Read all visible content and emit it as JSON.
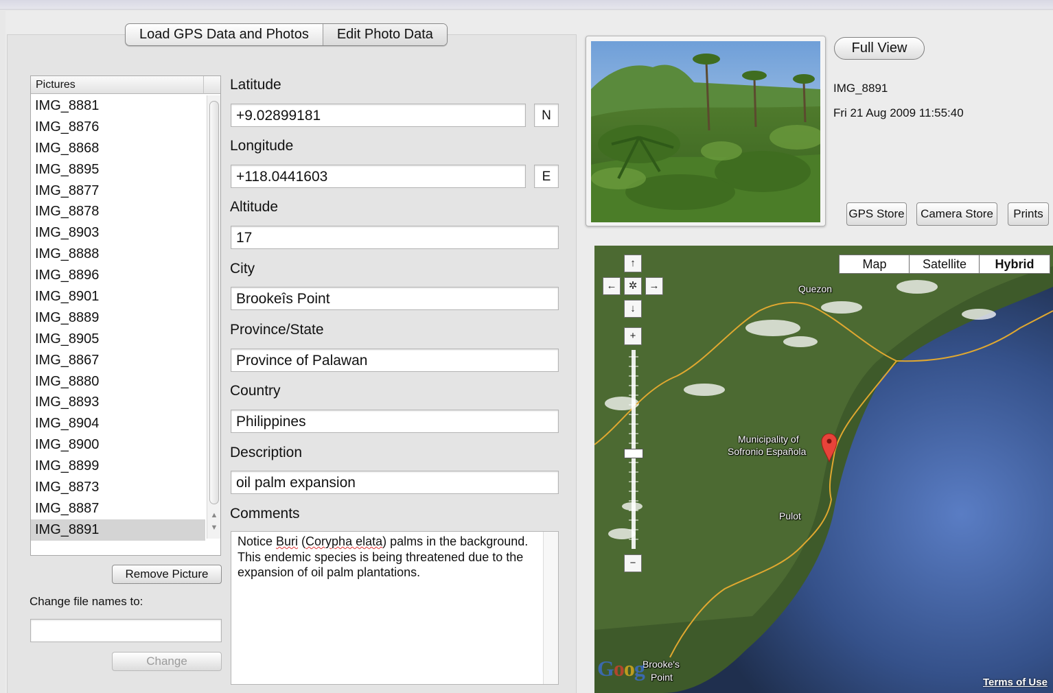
{
  "tabs": [
    {
      "label": "Load GPS Data and Photos",
      "active": false
    },
    {
      "label": "Edit Photo Data",
      "active": true
    }
  ],
  "pictures": {
    "header": "Pictures",
    "items": [
      "IMG_8881",
      "IMG_8876",
      "IMG_8868",
      "IMG_8895",
      "IMG_8877",
      "IMG_8878",
      "IMG_8903",
      "IMG_8888",
      "IMG_8896",
      "IMG_8901",
      "IMG_8889",
      "IMG_8905",
      "IMG_8867",
      "IMG_8880",
      "IMG_8893",
      "IMG_8904",
      "IMG_8900",
      "IMG_8899",
      "IMG_8873",
      "IMG_8887",
      "IMG_8891"
    ],
    "selected": "IMG_8891",
    "remove_button": "Remove Picture",
    "rename_label": "Change file names to:",
    "rename_value": "",
    "change_button": "Change"
  },
  "form": {
    "latitude_label": "Latitude",
    "latitude_value": "+9.02899181",
    "latitude_dir": "N",
    "longitude_label": "Longitude",
    "longitude_value": "+118.0441603",
    "longitude_dir": "E",
    "altitude_label": "Altitude",
    "altitude_value": "17",
    "city_label": "City",
    "city_value": "Brookeîs Point",
    "province_label": "Province/State",
    "province_value": "Province of Palawan",
    "country_label": "Country",
    "country_value": "Philippines",
    "description_label": "Description",
    "description_value": "oil palm expansion",
    "comments_label": "Comments",
    "comments": {
      "part1": "Notice ",
      "spell1": "Buri",
      "part2": " (",
      "spell2": "Corypha elata",
      "part3": ") palms in the background. This endemic species is being threatened due to the expansion of oil palm plantations."
    }
  },
  "photo": {
    "full_view_button": "Full View",
    "name": "IMG_8891",
    "datetime": "Fri 21 Aug 2009 11:55:40",
    "gps_store_button": "GPS Store",
    "camera_store_button": "Camera Store",
    "prints_button": "Prints"
  },
  "map": {
    "types": [
      {
        "label": "Map",
        "active": false
      },
      {
        "label": "Satellite",
        "active": false
      },
      {
        "label": "Hybrid",
        "active": true
      }
    ],
    "place_labels": {
      "quezon": "Quezon",
      "municipality_line1": "Municipality of",
      "municipality_line2": "Sofronio Española",
      "pulot": "Pulot",
      "brookes_line1": "Brooke's",
      "brookes_line2": "Point"
    },
    "logo": "Google",
    "terms": "Terms of Use",
    "marker_color": "#e8433a",
    "road_color": "#e0a830"
  }
}
